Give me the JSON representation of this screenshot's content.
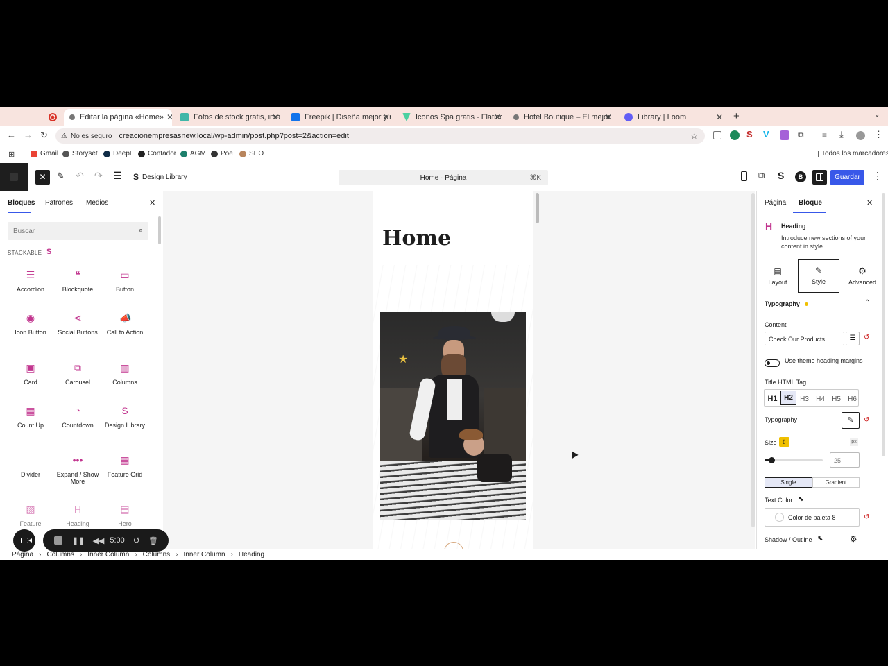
{
  "browser": {
    "tabs": [
      {
        "title": "",
        "favicon": "record-icon",
        "color": "#d93025"
      },
      {
        "title": "Editar la página «Home»",
        "favicon": "wp-icon",
        "color": "#555"
      },
      {
        "title": "Fotos de stock gratis, imágen",
        "favicon": "freepik-icon",
        "color": "#3fb7a8"
      },
      {
        "title": "Freepik | Diseña mejor y más",
        "favicon": "freepik-f-icon",
        "color": "#1273eb"
      },
      {
        "title": "Iconos Spa gratis - Flaticon",
        "favicon": "flaticon-icon",
        "color": "#4bd0a0"
      },
      {
        "title": "Hotel Boutique – El mejor hot",
        "favicon": "wp-icon",
        "color": "#555"
      },
      {
        "title": "Library | Loom",
        "favicon": "loom-icon",
        "color": "#625df5"
      }
    ],
    "new_tab": "+",
    "security": "No es seguro",
    "url": "creacionempresasnew.local/wp-admin/post.php?post=2&action=edit",
    "bookmarks": [
      "Gmail",
      "Storyset",
      "DeepL",
      "Contador",
      "AGM",
      "Poe",
      "SEO"
    ],
    "all_bookmarks": "Todos los marcadores"
  },
  "editor": {
    "design_library": "Design Library",
    "command_title": "Home · Página",
    "command_shortcut": "⌘K",
    "save": "Guardar",
    "accent": "#3858e9"
  },
  "left": {
    "tabs": [
      "Bloques",
      "Patrones",
      "Medios"
    ],
    "search_placeholder": "Buscar",
    "section": "STACKABLE",
    "blocks": [
      {
        "label": "Accordion",
        "icon": "accordion-icon"
      },
      {
        "label": "Blockquote",
        "icon": "blockquote-icon"
      },
      {
        "label": "Button",
        "icon": "button-icon"
      },
      {
        "label": "Icon Button",
        "icon": "icon-button-icon"
      },
      {
        "label": "Social Buttons",
        "icon": "social-buttons-icon"
      },
      {
        "label": "Call to Action",
        "icon": "megaphone-icon"
      },
      {
        "label": "Card",
        "icon": "card-icon"
      },
      {
        "label": "Carousel",
        "icon": "carousel-icon"
      },
      {
        "label": "Columns",
        "icon": "columns-icon"
      },
      {
        "label": "Count Up",
        "icon": "count-up-icon"
      },
      {
        "label": "Countdown",
        "icon": "countdown-icon"
      },
      {
        "label": "Design Library",
        "icon": "stackable-icon"
      },
      {
        "label": "Divider",
        "icon": "divider-icon"
      },
      {
        "label": "Expand / Show More",
        "icon": "expand-icon"
      },
      {
        "label": "Feature Grid",
        "icon": "feature-grid-icon"
      },
      {
        "label": "Feature",
        "icon": "feature-icon"
      },
      {
        "label": "Heading",
        "icon": "heading-icon"
      },
      {
        "label": "Hero",
        "icon": "hero-icon"
      }
    ]
  },
  "canvas": {
    "heading": "Home"
  },
  "right": {
    "tabs": [
      "Página",
      "Bloque"
    ],
    "block_name": "Heading",
    "block_desc": "Introduce new sections of your content in style.",
    "style_tabs": [
      "Layout",
      "Style",
      "Advanced"
    ],
    "typography_section": "Typography",
    "content_label": "Content",
    "content_value": "Check Our Products",
    "toggle_label": "Use theme heading margins",
    "tag_label": "Title HTML Tag",
    "tags": [
      "H1",
      "H2",
      "H3",
      "H4",
      "H5",
      "H6"
    ],
    "typography_label": "Typography",
    "size_label": "Size",
    "size_unit": "px",
    "size_value": "25",
    "size_fraction": 0.08,
    "color_type": [
      "Single",
      "Gradient"
    ],
    "text_color_label": "Text Color",
    "color_value": "Color de paleta 8",
    "shadow_label": "Shadow / Outline"
  },
  "breadcrumb": [
    "Página",
    "Columns",
    "Inner Column",
    "Columns",
    "Inner Column",
    "Heading"
  ],
  "loom": {
    "timer": "5:00"
  }
}
